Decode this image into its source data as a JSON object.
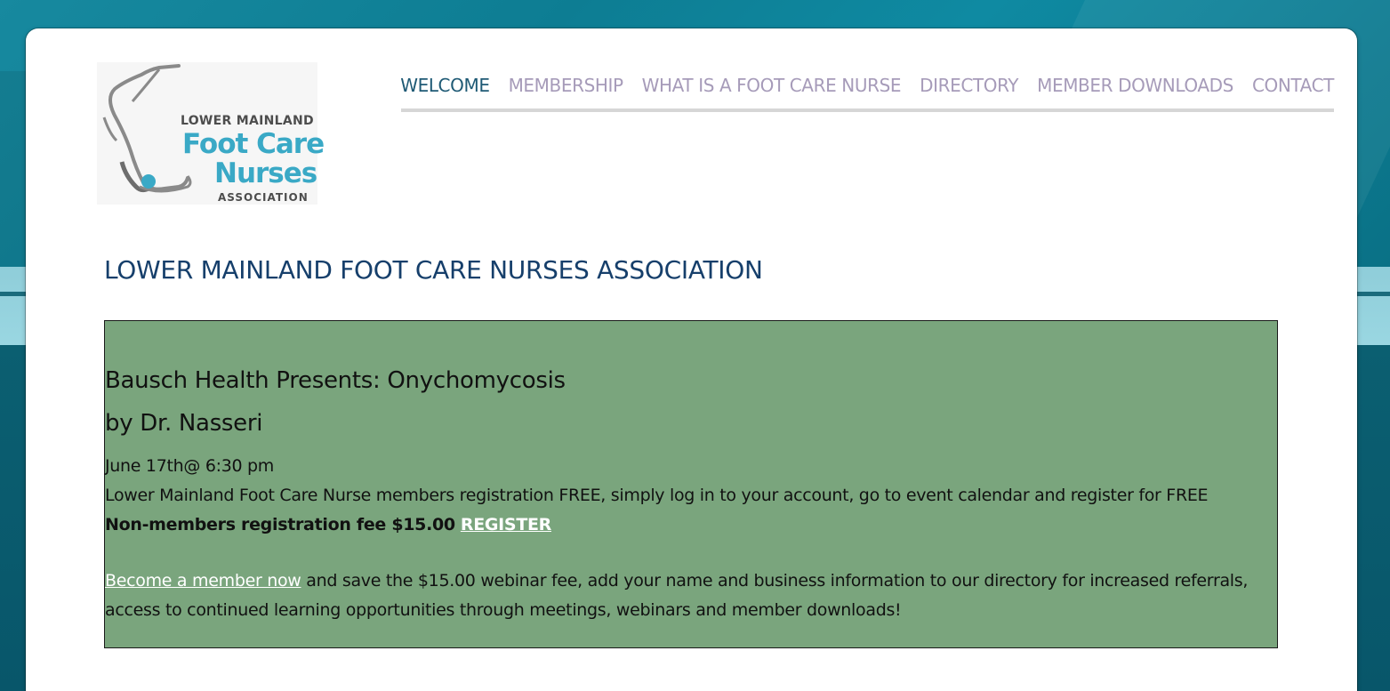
{
  "logo": {
    "line1": "LOWER MAINLAND",
    "line2": "Foot Care",
    "line3": "Nurses",
    "line4": "ASSOCIATION",
    "accent_color": "#3aa9c6"
  },
  "nav": {
    "items": [
      {
        "label": "WELCOME",
        "active": true
      },
      {
        "label": "MEMBERSHIP",
        "active": false
      },
      {
        "label": "WHAT IS A FOOT CARE NURSE",
        "active": false
      },
      {
        "label": "DIRECTORY",
        "active": false
      },
      {
        "label": "MEMBER DOWNLOADS",
        "active": false
      },
      {
        "label": "CONTACT",
        "active": false
      }
    ],
    "active_color": "#1f5a75",
    "inactive_color": "#a69bb9"
  },
  "page_title": "LOWER MAINLAND FOOT CARE NURSES ASSOCIATION",
  "event": {
    "title": "Bausch Health Presents: Onychomycosis",
    "presenter": "by Dr. Nasseri",
    "date": "June 17th@ 6:30 pm",
    "member_note": "Lower Mainland Foot Care Nurse members registration FREE, simply log in to your account, go to event calendar and register for FREE",
    "nonmember_fee": "Non-members registration fee $15.00",
    "register_label": "REGISTER",
    "join_link": "Become a member now",
    "join_text": " and save the $15.00 webinar fee, add your name and business information to our directory for increased referrals, access to continued learning opportunities through meetings, webinars and member downloads!",
    "box_color": "#7aa57d"
  }
}
